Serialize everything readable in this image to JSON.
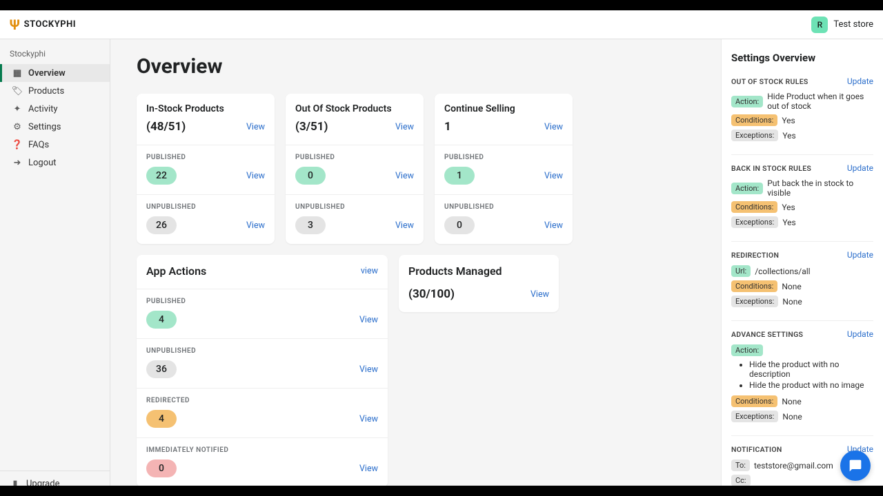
{
  "brand": {
    "name": "STOCKYPHI"
  },
  "store": {
    "initial": "R",
    "name": "Test store"
  },
  "sidebar": {
    "title": "Stockyphi",
    "items": [
      {
        "label": "Overview"
      },
      {
        "label": "Products"
      },
      {
        "label": "Activity"
      },
      {
        "label": "Settings"
      },
      {
        "label": "FAQs"
      },
      {
        "label": "Logout"
      }
    ],
    "upgrade": "Upgrade"
  },
  "page": {
    "title": "Overview",
    "view": "View",
    "viewLower": "view"
  },
  "summary": {
    "instock": {
      "title": "In-Stock Products",
      "value": "(48/51)",
      "published_label": "PUBLISHED",
      "published": "22",
      "unpublished_label": "UNPUBLISHED",
      "unpublished": "26"
    },
    "oos": {
      "title": "Out Of Stock Products",
      "value": "(3/51)",
      "published_label": "PUBLISHED",
      "published": "0",
      "unpublished_label": "UNPUBLISHED",
      "unpublished": "3"
    },
    "continue": {
      "title": "Continue Selling",
      "value": "1",
      "published_label": "PUBLISHED",
      "published": "1",
      "unpublished_label": "UNPUBLISHED",
      "unpublished": "0"
    }
  },
  "actions": {
    "title": "App Actions",
    "published_label": "PUBLISHED",
    "published": "4",
    "unpublished_label": "UNPUBLISHED",
    "unpublished": "36",
    "redirected_label": "REDIRECTED",
    "redirected": "4",
    "notified_label": "IMMEDIATELY NOTIFIED",
    "notified": "0"
  },
  "managed": {
    "title": "Products Managed",
    "value": "(30/100)"
  },
  "settings": {
    "title": "Settings Overview",
    "update": "Update",
    "labels": {
      "action": "Action:",
      "conditions": "Conditions:",
      "exceptions": "Exceptions:",
      "url": "Url:",
      "to": "To:",
      "cc": "Cc:"
    },
    "oos_rules": {
      "title": "OUT OF STOCK RULES",
      "action": "Hide Product when it goes out of stock",
      "conditions": "Yes",
      "exceptions": "Yes"
    },
    "bis_rules": {
      "title": "BACK IN STOCK RULES",
      "action": "Put back the in stock to visible",
      "conditions": "Yes",
      "exceptions": "Yes"
    },
    "redirection": {
      "title": "REDIRECTION",
      "url": "/collections/all",
      "conditions": "None",
      "exceptions": "None"
    },
    "advance": {
      "title": "ADVANCE SETTINGS",
      "items": [
        "Hide the product with no description",
        "Hide the product with no image"
      ],
      "conditions": "None",
      "exceptions": "None"
    },
    "notification": {
      "title": "NOTIFICATION",
      "to": "teststore@gmail.com",
      "cc": ""
    }
  }
}
